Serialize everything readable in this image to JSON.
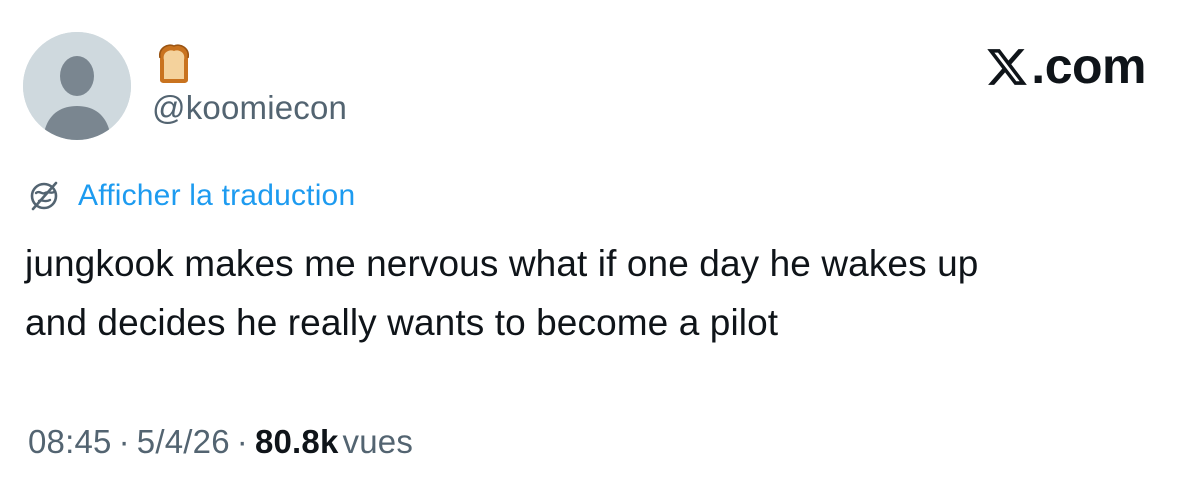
{
  "brand": {
    "label": ".com",
    "logo_icon": "x-logo-icon"
  },
  "author": {
    "display_name_icon": "bread-emoji-icon",
    "handle": "@koomiecon",
    "avatar_icon": "default-avatar-icon"
  },
  "translate": {
    "label": "Afficher la traduction",
    "icon": "translate-globe-icon",
    "color": "#1d9bf0"
  },
  "tweet": {
    "lines": [
      "jungkook makes me nervous what if one day he wakes up",
      "and decides he really wants to become a pilot"
    ]
  },
  "meta": {
    "time": "08:45",
    "separator": "·",
    "date": "5/4/26",
    "views_count": "80.8k",
    "views_label": "vues"
  },
  "colors": {
    "text_primary": "#0f1419",
    "text_secondary": "#536471",
    "avatar_bg": "#cfd9de",
    "avatar_fg": "#7a8690"
  }
}
